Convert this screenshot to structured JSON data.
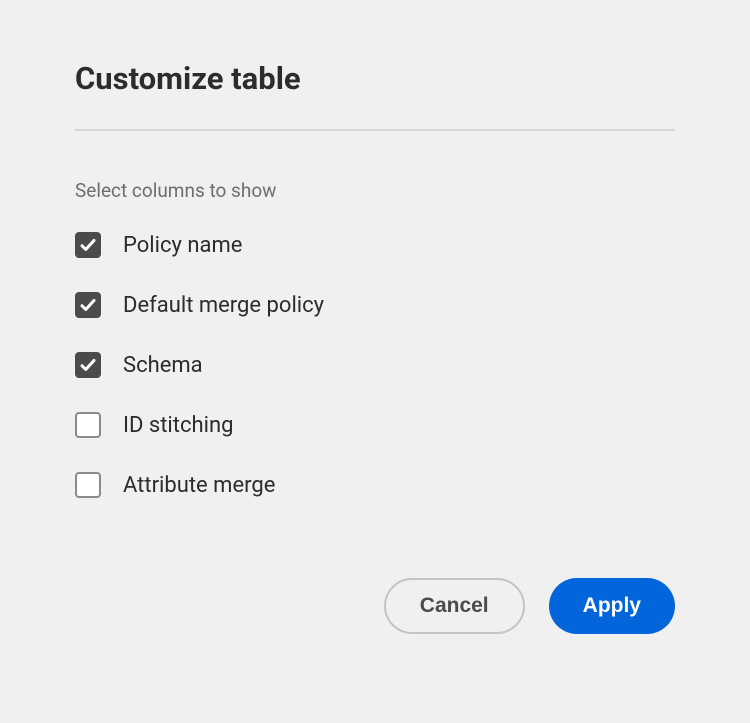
{
  "dialog": {
    "title": "Customize table",
    "subtitle": "Select columns to show",
    "options": [
      {
        "label": "Policy name",
        "checked": true
      },
      {
        "label": "Default merge policy",
        "checked": true
      },
      {
        "label": "Schema",
        "checked": true
      },
      {
        "label": "ID stitching",
        "checked": false
      },
      {
        "label": "Attribute merge",
        "checked": false
      }
    ],
    "buttons": {
      "cancel": "Cancel",
      "apply": "Apply"
    }
  }
}
